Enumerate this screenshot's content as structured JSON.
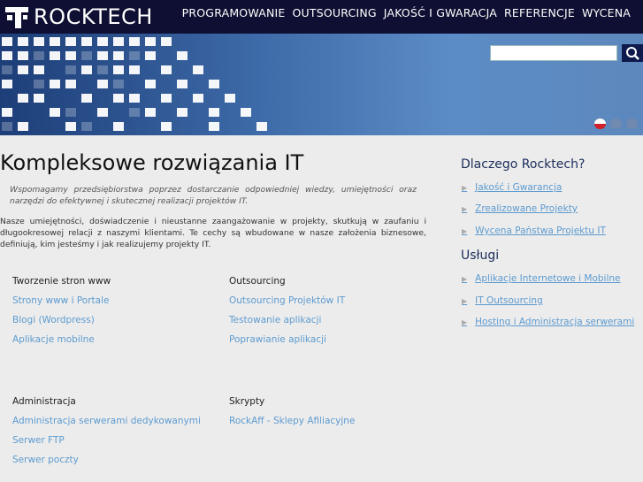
{
  "brand": {
    "name": "ROCKTECH"
  },
  "nav": [
    "PROGRAMOWANIE",
    "OUTSOURCING",
    "JAKOŚĆ I GWARACJA",
    "REFERENCJE",
    "WYCENA"
  ],
  "search": {
    "placeholder": ""
  },
  "languages": [
    "pl-flag-icon",
    "gb-flag-icon",
    "us-flag-icon"
  ],
  "main": {
    "title": "Kompleksowe rozwiązania IT",
    "lead": "Wspomagamy przedsiębiorstwa poprzez dostarczanie odpowiedniej wiedzy, umiejętności oraz narzędzi do efektywnej i skutecznej realizacji projektów IT.",
    "paragraph": "Nasze umiejętności, doświadczenie i nieustanne zaangażowanie w projekty, skutkują w zaufaniu i długookresowej relacji z naszymi klientami. Te cechy są wbudowane w nasze założenia biznesowe, definiują, kim jesteśmy i jak realizujemy projekty IT."
  },
  "services": [
    {
      "title": "Tworzenie stron www",
      "links": [
        "Strony www i Portale",
        "Blogi (Wordpress)",
        "Aplikacje mobilne"
      ]
    },
    {
      "title": "Outsourcing",
      "links": [
        "Outsourcing Projektów IT",
        "Testowanie aplikacji",
        "Poprawianie aplikacji"
      ]
    },
    {
      "title": "Administracja",
      "links": [
        "Administracja serwerami dedykowanymi",
        "Serwer FTP",
        "Serwer poczty"
      ]
    },
    {
      "title": "Skrypty",
      "links": [
        "RockAff - Sklepy Afiliacyjne"
      ]
    }
  ],
  "sidebar": {
    "why_title": "Dlaczego Rocktech?",
    "why_links": [
      "Jakość i Gwarancja",
      "Zrealizowane Projekty",
      "Wycena Państwa Projektu IT"
    ],
    "services_title": "Usługi",
    "services_links": [
      "Aplikacje Internetowe i Mobilne",
      "IT Outsourcing",
      "Hosting i Administracja serwerami"
    ]
  },
  "colors": {
    "topbar": "#0f0f33",
    "link": "#5d9bd0",
    "background": "#ececec"
  }
}
